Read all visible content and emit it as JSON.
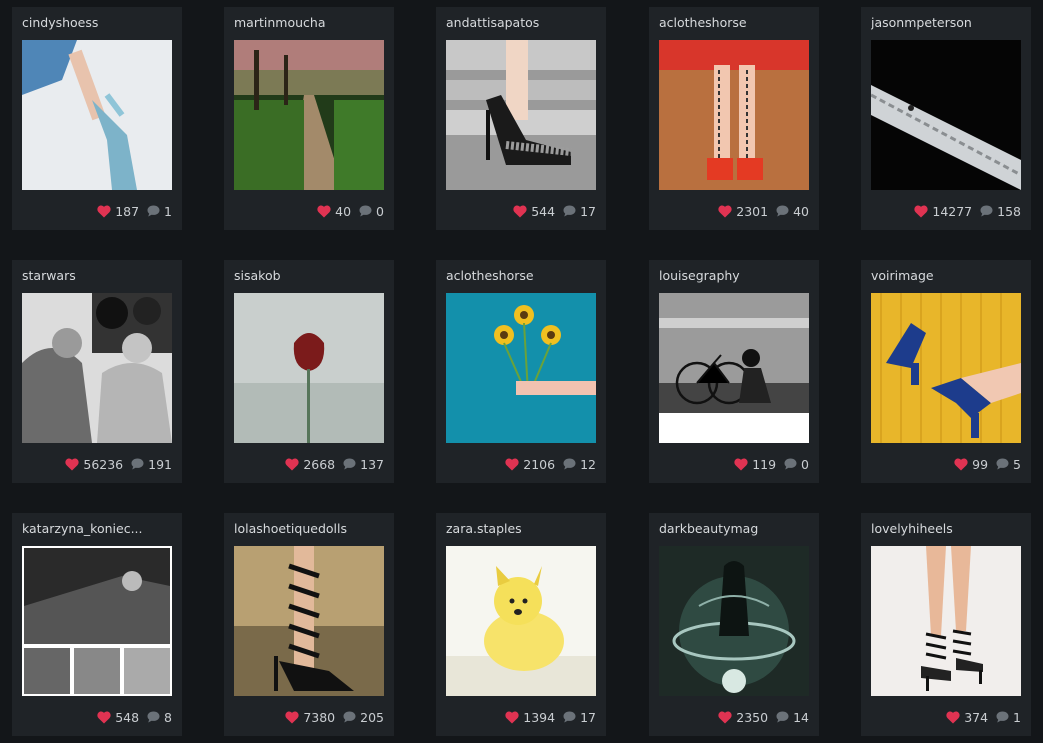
{
  "colors": {
    "page_background": "#131619",
    "card_background": "#1f2327",
    "heart": "#e03352",
    "comment": "#6b7279",
    "text": "#d7dadd"
  },
  "posts": [
    {
      "username": "cindyshoess",
      "likes": "187",
      "comments": "1",
      "image": "leg-blue-heels-photo"
    },
    {
      "username": "martinmoucha",
      "likes": "40",
      "comments": "0",
      "image": "forest-path-photo"
    },
    {
      "username": "andattisapatos",
      "likes": "544",
      "comments": "17",
      "image": "black-sandal-steps-photo"
    },
    {
      "username": "aclotheshorse",
      "likes": "2301",
      "comments": "40",
      "image": "red-dress-tattooed-legs-photo"
    },
    {
      "username": "jasonmpeterson",
      "likes": "14277",
      "comments": "158",
      "image": "aerial-bridge-photo"
    },
    {
      "username": "starwars",
      "likes": "56236",
      "comments": "191",
      "image": "film-set-camera-photo"
    },
    {
      "username": "sisakob",
      "likes": "2668",
      "comments": "137",
      "image": "red-tulip-photo"
    },
    {
      "username": "aclotheshorse",
      "likes": "2106",
      "comments": "12",
      "image": "sunflowers-hand-photo"
    },
    {
      "username": "louisegraphy",
      "likes": "119",
      "comments": "0",
      "image": "girl-bicycle-photo"
    },
    {
      "username": "voirimage",
      "likes": "99",
      "comments": "5",
      "image": "blue-heels-yellow-wall-photo"
    },
    {
      "username": "katarzyna_koniec...",
      "likes": "548",
      "comments": "8",
      "image": "fashion-collage-photo"
    },
    {
      "username": "lolashoetiquedolls",
      "likes": "7380",
      "comments": "205",
      "image": "strappy-black-heels-photo"
    },
    {
      "username": "zara.staples",
      "likes": "1394",
      "comments": "17",
      "image": "yellow-puppy-photo"
    },
    {
      "username": "darkbeautymag",
      "likes": "2350",
      "comments": "14",
      "image": "dark-fantasy-art-photo"
    },
    {
      "username": "lovelyhiheels",
      "likes": "374",
      "comments": "1",
      "image": "strappy-heels-legs-photo"
    }
  ]
}
